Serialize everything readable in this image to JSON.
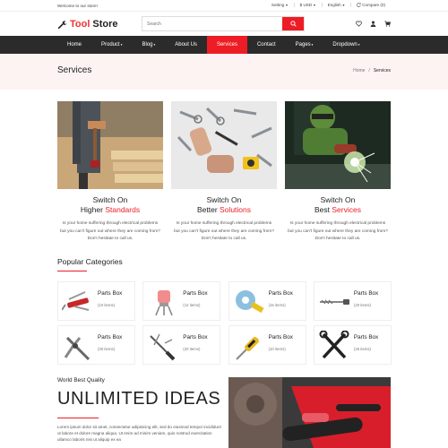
{
  "topbar": {
    "welcome": "Welcome to our store!",
    "setting": "Setting",
    "currency": "$ USD",
    "language": "English",
    "compare": "Compare (0)"
  },
  "header": {
    "logo_part1": "Tool",
    "logo_part2": "Store",
    "search_placeholder": "Search"
  },
  "nav": [
    {
      "label": "Home"
    },
    {
      "label": "Product"
    },
    {
      "label": "Blog"
    },
    {
      "label": "About Us"
    },
    {
      "label": "Services"
    },
    {
      "label": "Contact"
    },
    {
      "label": "Pages"
    },
    {
      "label": "Dropdown"
    }
  ],
  "banner": {
    "title": "Services",
    "crumb_home": "Home",
    "crumb_sep": "/",
    "crumb_current": "Services"
  },
  "services": [
    {
      "line1": "Switch On",
      "line2_prefix": "Higher",
      "line2_highlight": "Standards",
      "desc": "Is your home suffering through electrical problems but you can't figure out where they are coming from? Don't hesitate to call us."
    },
    {
      "line1": "Switch On",
      "line2_prefix": "Better",
      "line2_highlight": "Solutions",
      "desc": "Is your home suffering through electrical problems but you can't figure out where they are coming from? Don't hesitate to call us."
    },
    {
      "line1": "Switch On",
      "line2_prefix": "Best",
      "line2_highlight": "Services",
      "desc": "Is your home suffering through electrical problems but you can't figure out where they are coming from? Don't hesitate to call us."
    }
  ],
  "categories": {
    "title": "Popular Categories",
    "items": [
      {
        "name": "Parts Box",
        "count": "(10 items)",
        "icon": "multitool-icon"
      },
      {
        "name": "Parts Box",
        "count": "(12 items)",
        "icon": "paint-roller-icon"
      },
      {
        "name": "Parts Box",
        "count": "(15 items)",
        "icon": "tape-measure-icon"
      },
      {
        "name": "Parts Box",
        "count": "(20 items)",
        "icon": "drill-bit-icon"
      },
      {
        "name": "Parts Box",
        "count": "(30 items)",
        "icon": "pliers-icon"
      },
      {
        "name": "Parts Box",
        "count": "(20 items)",
        "icon": "screwdriver-set-icon"
      },
      {
        "name": "Parts Box",
        "count": "(10 items)",
        "icon": "screwdriver-icon"
      },
      {
        "name": "Parts Box",
        "count": "(25 items)",
        "icon": "crossed-tools-icon"
      }
    ]
  },
  "promo": {
    "kicker": "World Best Quality",
    "headline": "UNLIMITED IDEAS",
    "text": "Lorem ipsum dolor sit amet, consectetur adipisicing elit, sed do eiusmod tempor incididunt ut labore et dolore magna aliqua. Ut enim ad minim veniam, quis nostrud exercitation ullamco laboris nisi ut aliquip ex ea"
  },
  "colors": {
    "accent": "#ee1c25",
    "nav_bg": "#2b2b2b",
    "banner_bg": "#fdf3f3"
  }
}
